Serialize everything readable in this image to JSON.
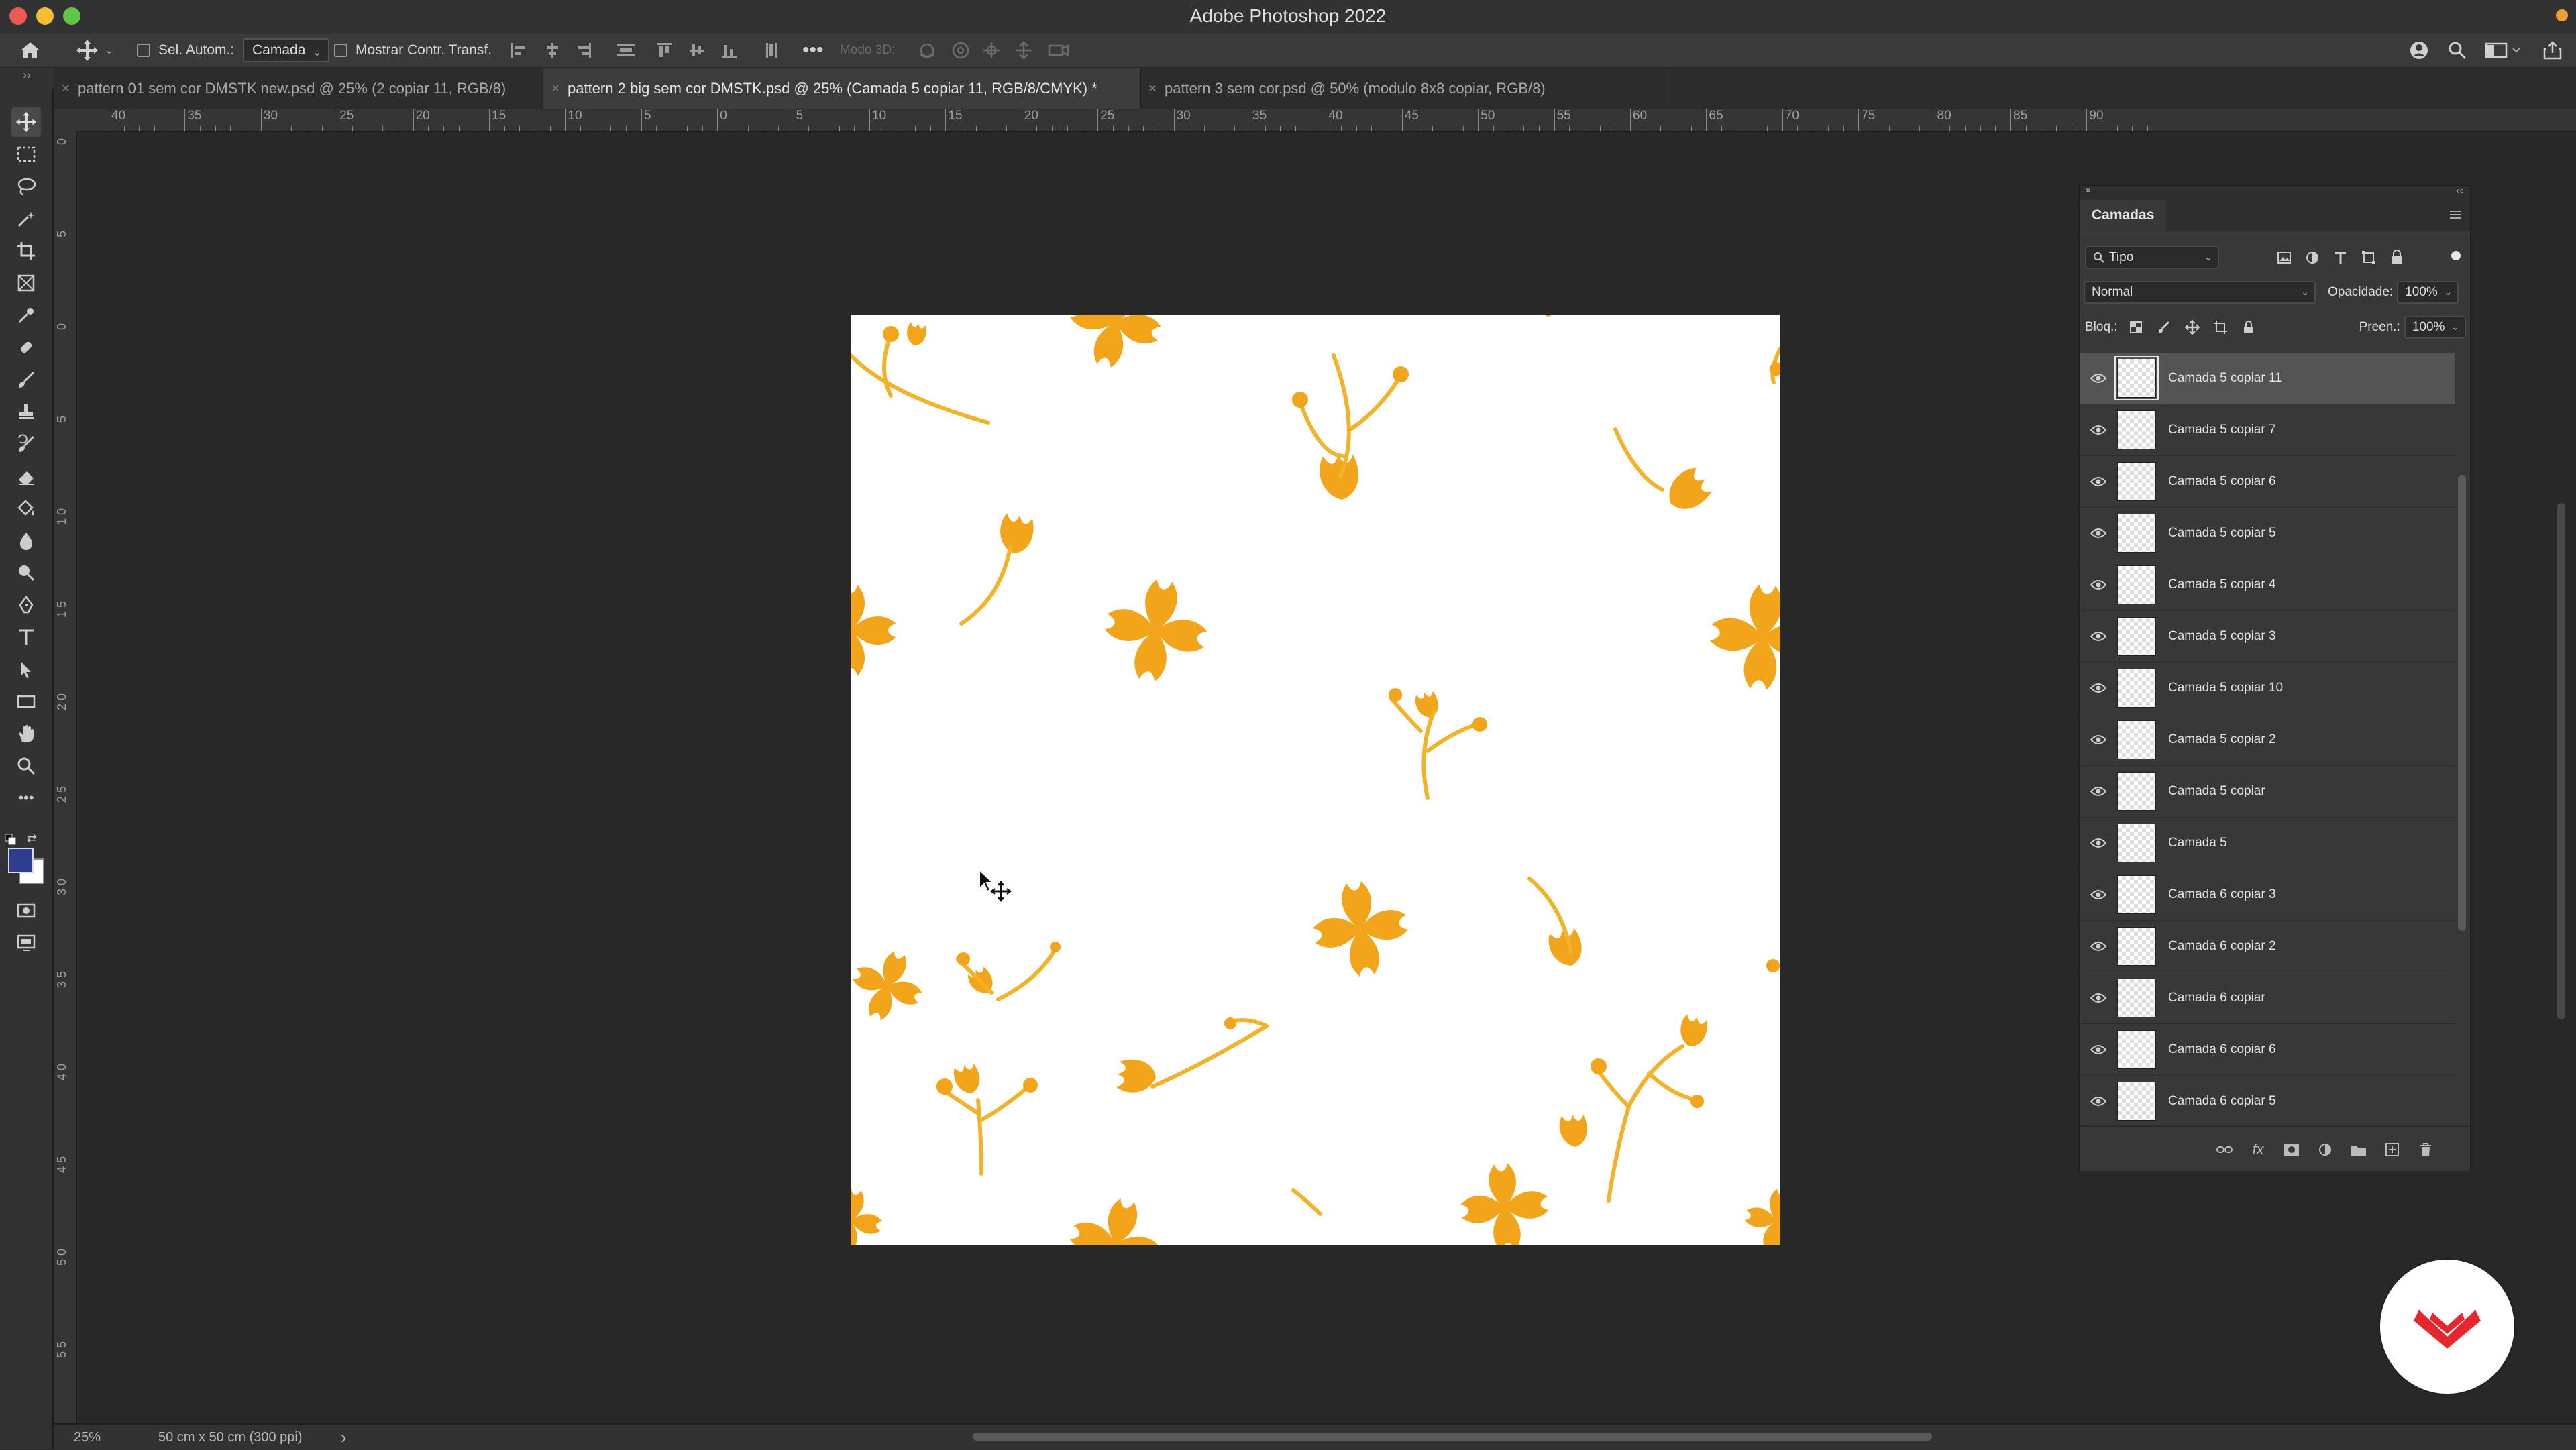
{
  "app": {
    "title": "Adobe Photoshop 2022",
    "accent": "#5a8fe0"
  },
  "options_bar": {
    "auto_select_label": "Sel. Autom.:",
    "auto_select_value": "Camada",
    "show_transform_label": "Mostrar Contr. Transf.",
    "mode_3d_label": "Modo 3D:"
  },
  "tabs": [
    {
      "label": "pattern 01 sem cor DMSTK new.psd @ 25% (2 copiar 11, RGB/8)",
      "active": false
    },
    {
      "label": "pattern 2 big sem cor DMSTK.psd @ 25% (Camada 5 copiar 11, RGB/8/CMYK) *",
      "active": true
    },
    {
      "label": "pattern 3 sem cor.psd @ 50% (modulo 8x8 copiar, RGB/8)",
      "active": false
    }
  ],
  "ruler_top_labels": [
    "40",
    "35",
    "30",
    "25",
    "20",
    "15",
    "10",
    "5",
    "0",
    "5",
    "10",
    "15",
    "20",
    "25",
    "30",
    "35",
    "40",
    "45",
    "50",
    "55",
    "60",
    "65",
    "70",
    "75",
    "80",
    "85",
    "90"
  ],
  "ruler_left_labels": [
    "0",
    "5",
    "0",
    "5",
    "1 0",
    "1 5",
    "2 0",
    "2 5",
    "3 0",
    "3 5",
    "4 0",
    "4 5",
    "5 0",
    "5 5"
  ],
  "status": {
    "zoom": "25%",
    "doc_size": "50 cm x 50 cm (300 ppi)",
    "arrow": "›"
  },
  "colors": {
    "foreground": "#2f3d8f",
    "background": "#ffffff",
    "flower": "#f2a51a"
  },
  "layers_panel": {
    "tab_label": "Camadas",
    "filter_label": "Tipo",
    "blend_mode": "Normal",
    "opacity_label": "Opacidade:",
    "opacity_value": "100%",
    "lock_label": "Bloq.:",
    "fill_label": "Preen.:",
    "fill_value": "100%",
    "layers": [
      {
        "name": "Camada 5 copiar 11",
        "selected": true
      },
      {
        "name": "Camada 5 copiar 7",
        "selected": false
      },
      {
        "name": "Camada 5 copiar 6",
        "selected": false
      },
      {
        "name": "Camada 5 copiar 5",
        "selected": false
      },
      {
        "name": "Camada 5 copiar 4",
        "selected": false
      },
      {
        "name": "Camada 5 copiar 3",
        "selected": false
      },
      {
        "name": "Camada 5 copiar 10",
        "selected": false
      },
      {
        "name": "Camada 5 copiar 2",
        "selected": false
      },
      {
        "name": "Camada 5 copiar",
        "selected": false
      },
      {
        "name": "Camada 5",
        "selected": false
      },
      {
        "name": "Camada 6 copiar 3",
        "selected": false
      },
      {
        "name": "Camada 6 copiar 2",
        "selected": false
      },
      {
        "name": "Camada 6 copiar",
        "selected": false
      },
      {
        "name": "Camada 6 copiar 6",
        "selected": false
      },
      {
        "name": "Camada 6 copiar 5",
        "selected": false
      }
    ]
  }
}
